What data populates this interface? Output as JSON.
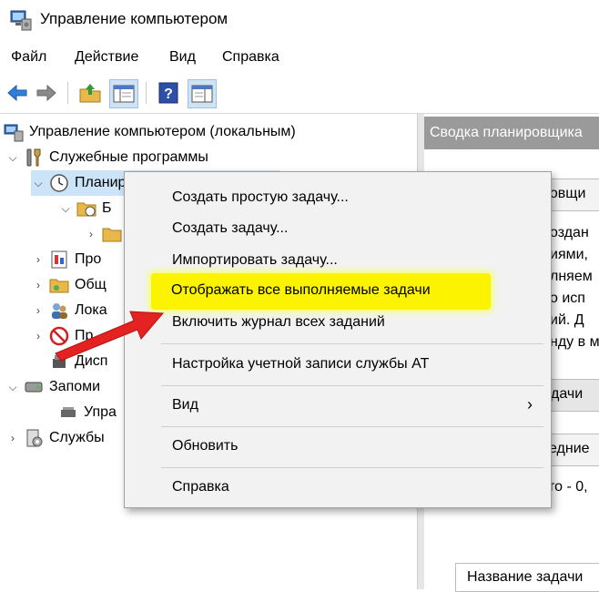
{
  "window": {
    "title": "Управление компьютером"
  },
  "menubar": {
    "items": [
      "Файл",
      "Действие",
      "Вид",
      "Справка"
    ]
  },
  "toolbar": {
    "icons": [
      "back-arrow-icon",
      "forward-arrow-icon",
      "up-folder-icon",
      "show-hide-tree-icon",
      "help-icon",
      "action-pane-icon"
    ]
  },
  "tree": {
    "root": "Управление компьютером (локальным)",
    "system_tools": "Служебные программы",
    "task_scheduler": "Планировщик заданий",
    "library": "Б",
    "row_performance": "Про",
    "row_shared": "Общ",
    "row_users": "Лока",
    "row_perf": "Пр",
    "row_device": "Дисп",
    "storage": "Запоми",
    "storage_child": "Упра",
    "services": "Службы"
  },
  "right_pane": {
    "header": "Сводка планировщика",
    "box1_title": "ровщи",
    "lines": [
      "оздан",
      "иями,",
      "лняем",
      "о исп",
      "ий. Д",
      "нду в м"
    ],
    "tab_label": "дачи",
    "tab2_label": "едние",
    "period": "то - 0,",
    "column": "Название задачи"
  },
  "context_menu": {
    "items": [
      "Создать простую задачу...",
      "Создать задачу...",
      "Импортировать задачу...",
      "Отображать все выполняемые задачи",
      "Включить журнал всех заданий",
      "Настройка учетной записи службы AT",
      "Вид",
      "Обновить",
      "Справка"
    ],
    "submenu_arrow": "›"
  },
  "colors": {
    "highlight": "#fbf300",
    "arrow": "#e52222",
    "header_gray": "#9a9a9a"
  }
}
